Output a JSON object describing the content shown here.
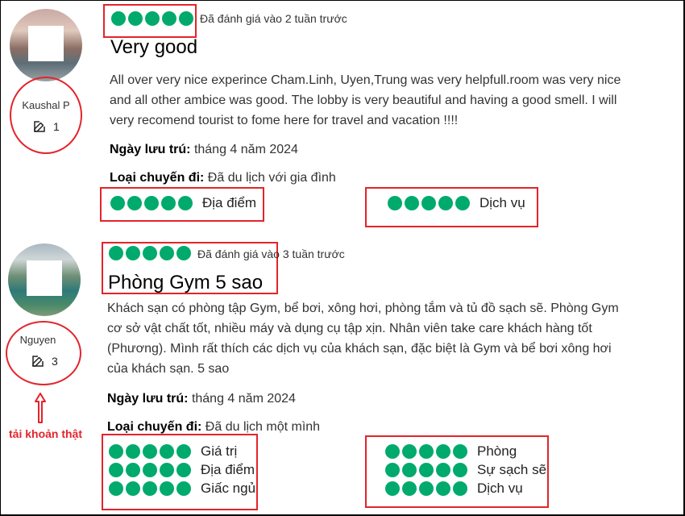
{
  "colors": {
    "star": "#00aa6c",
    "highlight": "#e3242b"
  },
  "reviews": [
    {
      "user": {
        "name": "Kaushal P",
        "contributions": "1"
      },
      "rating_count": 5,
      "date": "Đã đánh giá vào 2 tuần trước",
      "title": "Very good",
      "body": [
        "All over very nice experince Cham.Linh, Uyen,Trung was very helpfull.room was very nice",
        "and all other ambice was good. The lobby is very beautiful and having a good smell. I will",
        "very recomend tourist to fome here for travel and vacation !!!!"
      ],
      "stay_label": "Ngày lưu trú:",
      "stay_value": "tháng 4 năm 2024",
      "trip_label": "Loại chuyến đi:",
      "trip_value": "Đã du lịch với gia đình",
      "subratings": [
        "Địa điểm",
        "Dịch vụ"
      ]
    },
    {
      "user": {
        "name": "Nguyen",
        "contributions": "3"
      },
      "rating_count": 5,
      "date": "Đã đánh giá vào 3 tuần trước",
      "title": "Phòng Gym 5 sao",
      "body": [
        "Khách sạn có phòng tập Gym, bể bơi, xông hơi, phòng tắm và tủ đồ sạch sẽ. Phòng Gym",
        "cơ sở vật chất tốt, nhiều máy và dụng cụ tập xịn. Nhân viên take care khách hàng tốt",
        "(Phương). Mình rất thích các dịch vụ của khách sạn, đặc biệt là Gym và bể bơi xông hơi",
        "của khách sạn. 5 sao"
      ],
      "stay_label": "Ngày lưu trú:",
      "stay_value": "tháng 4 năm 2024",
      "trip_label": "Loại chuyến đi:",
      "trip_value": "Đã du lịch một mình",
      "subratings_left": [
        "Giá trị",
        "Địa điểm",
        "Giấc ngủ"
      ],
      "subratings_right": [
        "Phòng",
        "Sự sạch sẽ",
        "Dịch vụ"
      ]
    }
  ],
  "annotation": {
    "note": "tải khoản thật"
  }
}
